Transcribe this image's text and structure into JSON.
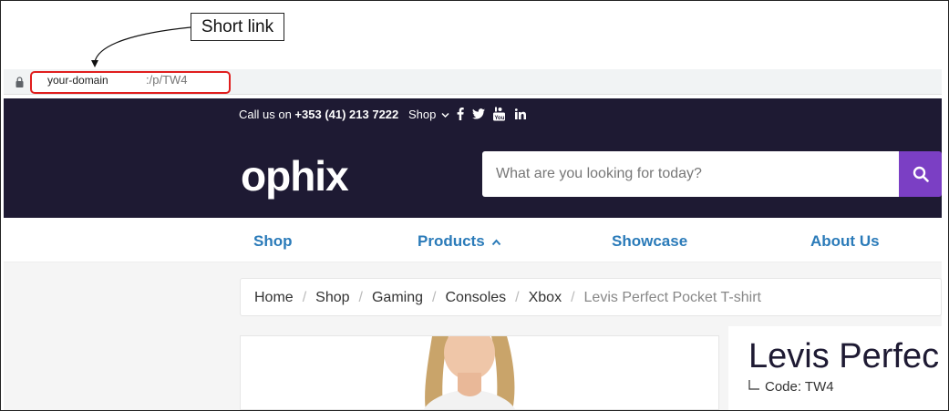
{
  "annotation": {
    "label": "Short link"
  },
  "browser": {
    "url_domain": "your-domain",
    "url_path": ":/p/TW4"
  },
  "topbar": {
    "call_prefix": "Call us on ",
    "phone": "+353 (41) 213 7222",
    "shop_label": "Shop",
    "social_icons": [
      "facebook-icon",
      "twitter-icon",
      "youtube-icon",
      "linkedin-icon"
    ]
  },
  "header": {
    "logo_text": "ophix",
    "search_placeholder": "What are you looking for today?"
  },
  "nav": {
    "items": [
      "Shop",
      "Products",
      "Showcase",
      "About Us"
    ]
  },
  "breadcrumb": {
    "items": [
      "Home",
      "Shop",
      "Gaming",
      "Consoles",
      "Xbox"
    ],
    "current": "Levis Perfect Pocket T-shirt"
  },
  "product": {
    "title": "Levis Perfec",
    "code_label": "Code: TW4"
  },
  "colors": {
    "header_bg": "#1e1a33",
    "accent": "#7b3fc4",
    "nav_link": "#2b7bb9",
    "highlight_border": "#e01e1e"
  }
}
